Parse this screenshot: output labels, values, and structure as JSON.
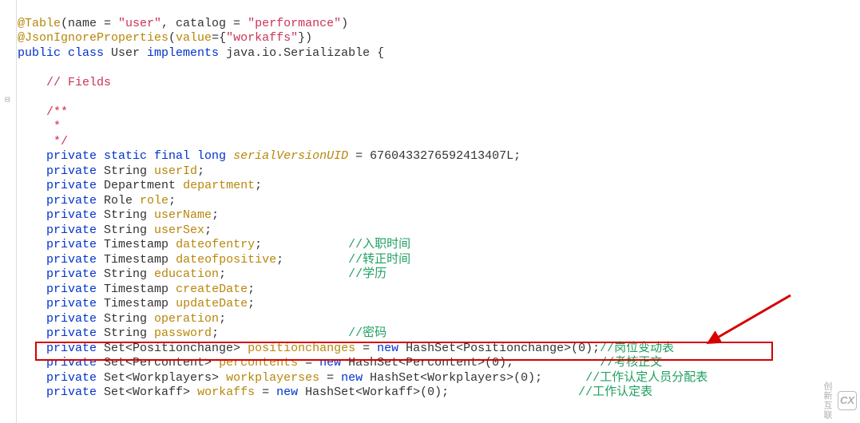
{
  "code": {
    "l1": {
      "a": "@Table",
      "b": "(name = ",
      "c": "\"user\"",
      "d": ", catalog = ",
      "e": "\"performance\"",
      "f": ")"
    },
    "l2": {
      "a": "@JsonIgnoreProperties",
      "b": "(",
      "c": "value",
      "d": "={",
      "e": "\"workaffs\"",
      "f": "})"
    },
    "l3": {
      "a": "public class ",
      "b": "User ",
      "c": "implements ",
      "d": "java.io.Serializable {"
    },
    "l5": {
      "a": "// Fields"
    },
    "l7": {
      "a": "/**"
    },
    "l8": {
      "a": " *"
    },
    "l9": {
      "a": " */"
    },
    "l10": {
      "a": "private static final long ",
      "b": "serialVersionUID",
      "c": " = 6760433276592413407L;"
    },
    "l11": {
      "a": "private",
      "b": " String ",
      "c": "userId",
      "d": ";"
    },
    "l12": {
      "a": "private",
      "b": " Department ",
      "c": "department",
      "d": ";"
    },
    "l13": {
      "a": "private",
      "b": " Role ",
      "c": "role",
      "d": ";"
    },
    "l14": {
      "a": "private",
      "b": " String ",
      "c": "userName",
      "d": ";"
    },
    "l15": {
      "a": "private",
      "b": " String ",
      "c": "userSex",
      "d": ";"
    },
    "l16": {
      "a": "private",
      "b": " Timestamp ",
      "c": "dateofentry",
      "d": ";",
      "e": "//入职时间"
    },
    "l17": {
      "a": "private",
      "b": " Timestamp ",
      "c": "dateofpositive",
      "d": ";",
      "e": "//转正时间"
    },
    "l18": {
      "a": "private",
      "b": " String ",
      "c": "education",
      "d": ";",
      "e": "//学历"
    },
    "l19": {
      "a": "private",
      "b": " Timestamp ",
      "c": "createDate",
      "d": ";"
    },
    "l20": {
      "a": "private",
      "b": " Timestamp ",
      "c": "updateDate",
      "d": ";"
    },
    "l21": {
      "a": "private",
      "b": " String ",
      "c": "operation",
      "d": ";"
    },
    "l22": {
      "a": "private",
      "b": " String ",
      "c": "password",
      "d": ";",
      "e": "//密码"
    },
    "l23": {
      "a": "private",
      "b": " Set<Positionchange> ",
      "c": "positionchanges",
      "d": " = ",
      "e": "new",
      "f": " HashSet<Positionchange>(0);",
      "g": "//岗位变动表"
    },
    "l24": {
      "a": "private",
      "b": " Set<Percontent> ",
      "c": "percontents",
      "d": " = ",
      "e": "new",
      "f": " HashSet<Percontent>(0);",
      "g": "//考核正文"
    },
    "l25": {
      "a": "private",
      "b": " Set<Workplayers> ",
      "c": "workplayerses",
      "d": " = ",
      "e": "new",
      "f": " HashSet<Workplayers>(0);",
      "g": "//工作认定人员分配表"
    },
    "l26": {
      "a": "private",
      "b": " Set<Workaff> ",
      "c": "workaffs",
      "d": " = ",
      "e": "new",
      "f": " HashSet<Workaff>(0);",
      "g": "//工作认定表"
    }
  },
  "watermark": {
    "logo": "CX",
    "text": "创新互联"
  }
}
